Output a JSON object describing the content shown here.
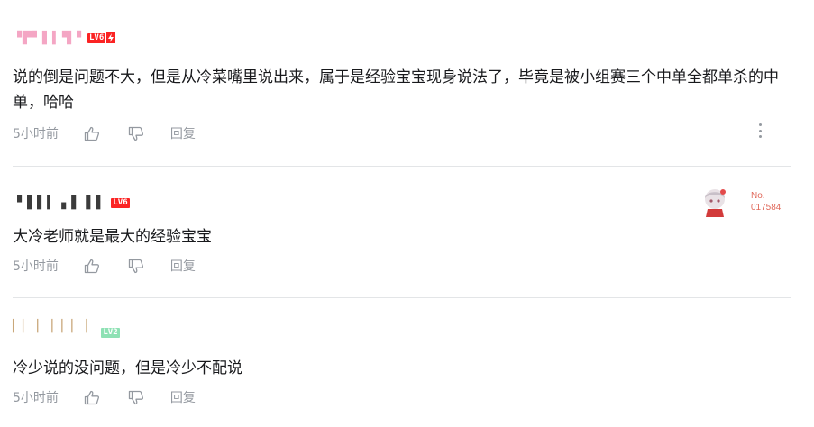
{
  "comments": [
    {
      "username": "▝▛▘▌▍▜▝",
      "level": "LV6",
      "level_color": "#fb2323",
      "username_color": "#f4a6c4",
      "text": "说的倒是问题不大，但是从冷菜嘴里说出来，属于是经验宝宝现身说法了，毕竟是被小组赛三个中单全都单杀的中单，哈哈",
      "time": "5小时前",
      "reply_label": "回复",
      "like_icon": "thumbs-up-icon",
      "dislike_icon": "thumbs-down-icon",
      "has_more_menu": true
    },
    {
      "username": "▝ ▌▌▍ ▖▌ ▌▌",
      "level": "LV6",
      "level_color": "#fb2323",
      "username_color": "#3b3b3b",
      "text": "大冷老师就是最大的经验宝宝",
      "time": "5小时前",
      "reply_label": "回复",
      "like_icon": "thumbs-up-icon",
      "dislike_icon": "thumbs-down-icon",
      "fan_badge": {
        "label": "No.",
        "number": "017584",
        "color": "#e0685a"
      }
    },
    {
      "username": "▏▏   ▏ ▏▏▏ ▏",
      "level": "LV2",
      "level_color": "#8ee1b4",
      "username_color": "#c9a77a",
      "text": "冷少说的没问题，但是冷少不配说",
      "time": "5小时前",
      "reply_label": "回复",
      "like_icon": "thumbs-up-icon",
      "dislike_icon": "thumbs-down-icon"
    }
  ]
}
